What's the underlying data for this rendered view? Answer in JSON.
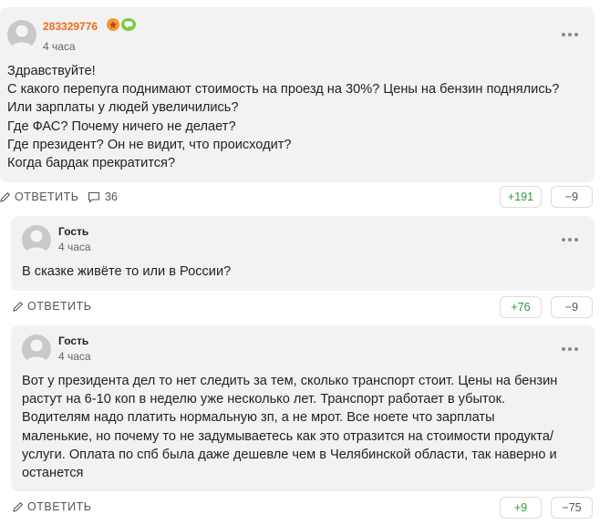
{
  "comments": [
    {
      "author": "283329776",
      "time": "4 часа",
      "lines": [
        "Здравствуйте!",
        "С какого перепуга поднимают стоимость на проезд на 30%? Цены на бензин поднялись?",
        "Или зарплаты у людей увеличились?",
        "Где ФАС? Почему ничего не делает?",
        "Где президент? Он не видит, что происходит?",
        "Когда бардак прекратится?"
      ],
      "reply_label": "ОТВЕТИТЬ",
      "replies_count": "36",
      "upvotes": "+191",
      "downvotes": "−9",
      "badge_icons": [
        "award-icon",
        "chat-badge-icon"
      ],
      "author_color": "#f06a1a"
    },
    {
      "author": "Гость",
      "time": "4 часа",
      "lines": [
        "В сказке живёте то или в России?"
      ],
      "reply_label": "ОТВЕТИТЬ",
      "upvotes": "+76",
      "downvotes": "−9"
    },
    {
      "author": "Гость",
      "time": "4 часа",
      "lines": [
        "Вот у президента дел то нет следить за тем, сколько транспорт стоит. Цены на бензин",
        "растут на 6-10 коп в неделю уже несколько лет. Транспорт работает в убыток.",
        "Водителям надо платить нормальную зп, а не мрот. Все ноете что зарплаты",
        "маленькие, но почему то не задумываетесь как это отразится на стоимости продукта/",
        "услуги. Оплата по спб была даже дешевле чем в Челябинской области, так наверно и",
        "останется"
      ],
      "reply_label": "ОТВЕТИТЬ",
      "upvotes": "+9",
      "downvotes": "−75"
    }
  ],
  "colors": {
    "card_bg": "#f2f2f2",
    "upvote": "#2e9a3a",
    "author_highlight": "#f06a1a"
  }
}
